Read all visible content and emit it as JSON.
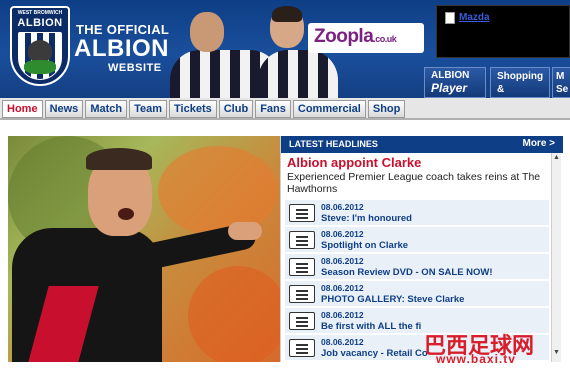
{
  "header": {
    "crest_top": "WEST BROMWICH",
    "crest_name": "ALBION",
    "the_official": "THE OFFICIAL",
    "albion": "ALBION",
    "website": "WEBSITE",
    "sponsor": "Zoopla",
    "sponsor_suffix": ".co.uk",
    "ad_link": "Mazda",
    "player_btn": {
      "line1": "ALBION",
      "line2": "Player"
    },
    "shop_btn": {
      "line1": "Shopping",
      "line2": "&"
    },
    "more_btn": {
      "line1": "M",
      "line2": "Se"
    }
  },
  "nav": {
    "tabs": [
      "Home",
      "News",
      "Match",
      "Team",
      "Tickets",
      "Club",
      "Fans",
      "Commercial",
      "Shop"
    ],
    "active": "Home"
  },
  "headlines": {
    "title": "LATEST HEADLINES",
    "more": "More >",
    "feature": {
      "title": "Albion appoint Clarke",
      "desc": "Experienced Premier League coach takes reins at The Hawthorns"
    },
    "items": [
      {
        "date": "08.06.2012",
        "text": "Steve: I'm honoured"
      },
      {
        "date": "08.06.2012",
        "text": "Spotlight on Clarke"
      },
      {
        "date": "08.06.2012",
        "text": "Season Review DVD - ON SALE NOW!"
      },
      {
        "date": "08.06.2012",
        "text": "PHOTO GALLERY: Steve Clarke"
      },
      {
        "date": "08.06.2012",
        "text": "Be first with ALL the fi"
      },
      {
        "date": "08.06.2012",
        "text": "Job vacancy - Retail Co"
      }
    ]
  },
  "watermark": {
    "cn": "巴西足球网",
    "url": "www.baxi.tv"
  }
}
